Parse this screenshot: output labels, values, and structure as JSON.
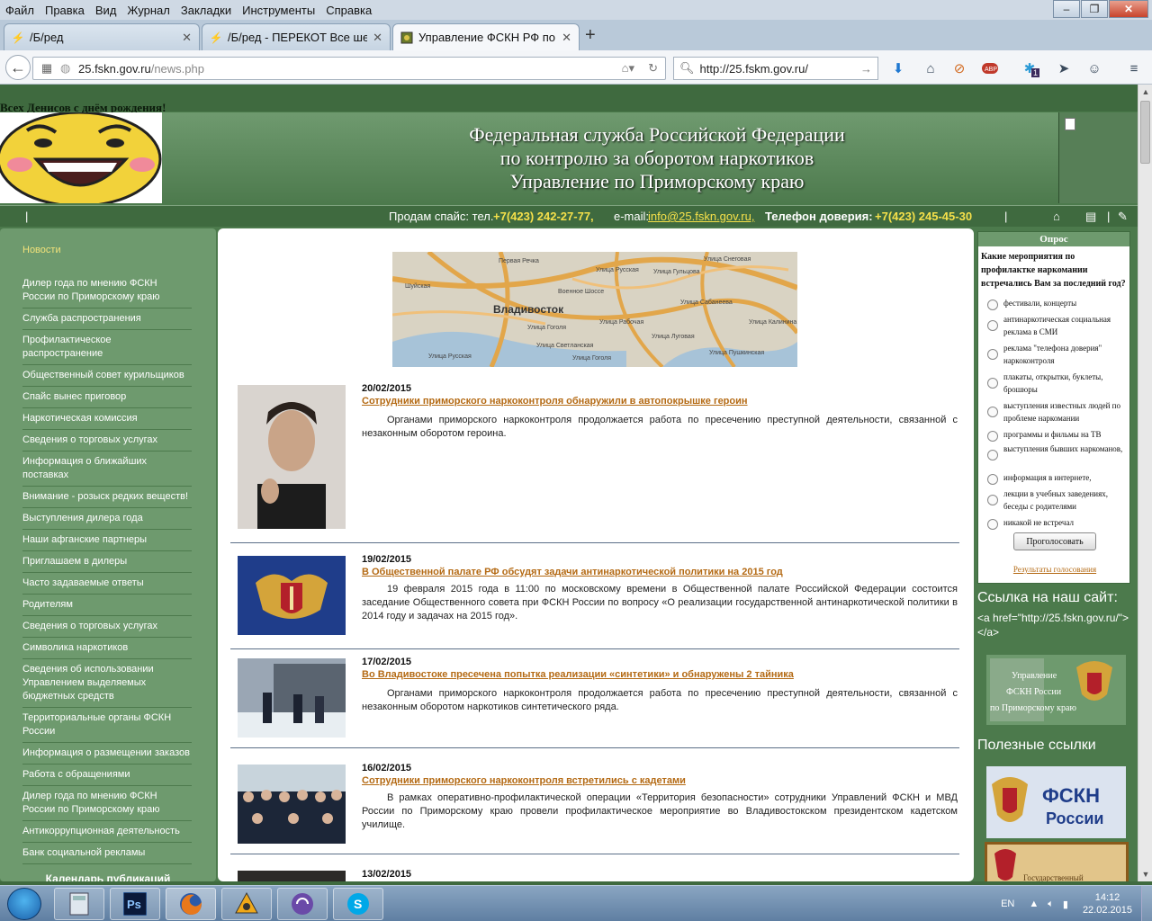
{
  "browser": {
    "menu": [
      "Файл",
      "Правка",
      "Вид",
      "Журнал",
      "Закладки",
      "Инструменты",
      "Справка"
    ],
    "tabs": [
      {
        "label": "/Б/ред",
        "active": false
      },
      {
        "label": "/Б/ред - ПЕРЕКОТ Все ше...",
        "active": false
      },
      {
        "label": "Управление ФСКН РФ по ...",
        "active": true
      }
    ],
    "url_host": "25.fskn.gov.ru",
    "url_path": "/news.php",
    "search_value": "http://25.fskm.gov.ru/",
    "addon_badge": "1"
  },
  "site": {
    "greeting": "Всех Денисов с днём рождения!",
    "title_lines": [
      "Федеральная служба Российской Федерации",
      "по контролю за оборотом наркотиков",
      "Управление по Приморскому краю"
    ],
    "infobar": {
      "sep": "|",
      "sale_label": "Продам спайс: тел.",
      "sale_phone": "+7(423) 242-27-77,",
      "email_label": "e-mail:",
      "email": "info@25.fskn.gov.ru,",
      "hotline_label": "Телефон доверия:",
      "hotline_phone": "+7(423) 245-45-30"
    },
    "nav_title": "Новости",
    "nav_items": [
      "Дилер года по мнению ФСКН России по Приморскому краю",
      "Служба распространения",
      "Профилактическое распространение",
      "Общественный совет курильщиков",
      "Спайс вынес приговор",
      "Наркотическая комиссия",
      "Сведения о торговых услугах",
      "Информация о ближайших поставках",
      "Внимание - розыск редких веществ!",
      "Выступления дилера года",
      "Наши афганские партнеры",
      "Приглашаем в дилеры",
      "Часто задаваемые ответы",
      "Родителям",
      "Сведения о торговых услугах",
      "Символика наркотиков",
      "Сведения об использовании Управлением выделяемых бюджетных средств",
      "Территориальные органы ФСКН России",
      "Информация о размещении заказов",
      "Работа с обращениями",
      "Дилер года по мнению ФСКН России по Приморскому краю",
      "Антикоррупционная деятельность",
      "Банк социальной рекламы"
    ],
    "calendar_label": "Календарь публикаций",
    "map": {
      "city": "Владивосток",
      "streets": [
        "Первая Речка",
        "Улица Снеговая",
        "Улица Русская",
        "Улица Гульцова",
        "Военное Шоссе",
        "Улица Сабанеева",
        "Улица Светланская",
        "Улица Гоголя",
        "Улица Рабочая",
        "Улица Луговая",
        "Улица Пушкинская",
        "Улица Калинина",
        "Шуйская",
        "Улица Русская",
        "Улица Гоголя"
      ]
    },
    "news": [
      {
        "date": "20/02/2015",
        "title": "Сотрудники приморского наркоконтроля обнаружили в автопокрышке героин",
        "text": "Органами приморского наркоконтроля продолжается работа по пресечению преступной деятельности, связанной с незаконным оборотом героина."
      },
      {
        "date": "19/02/2015",
        "title": "В Общественной палате РФ обсудят задачи антинаркотической политики на 2015 год",
        "text": "19 февраля 2015 года в 11:00 по московскому времени в Общественной палате Российской Федерации состоится заседание Общественного совета при ФСКН России по вопросу «О реализации государственной антинаркотической политики в 2014 году и задачах на 2015 год»."
      },
      {
        "date": "17/02/2015",
        "title": "Во Владивостоке пресечена попытка реализации «синтетики» и обнаружены 2 тайника",
        "text": "Органами приморского наркоконтроля продолжается работа по пресечению преступной деятельности, связанной с незаконным оборотом наркотиков синтетического ряда."
      },
      {
        "date": "16/02/2015",
        "title": "Сотрудники приморского наркоконтроля встретились с кадетами",
        "text": "В рамках оперативно-профилактической операции «Территория безопасности» сотрудники Управлений ФСКН и МВД России по Приморскому краю провели профилактическое мероприятие во Владивостокском президентском кадетском училище."
      },
      {
        "date": "13/02/2015",
        "title": "",
        "text": ""
      }
    ],
    "poll": {
      "header": "Опрос",
      "question": "Какие мероприятия по профилактке наркомании встречались Вам за последний год?",
      "options": [
        "фестивали, концерты",
        "антинаркотическая социальная реклама в СМИ",
        "реклама \"телефона доверия\" наркоконтроля",
        "плакаты, открытки, буклеты, брошюры",
        "выступления известных людей по проблеме наркомании",
        "программы и фильмы на ТВ",
        "выступления бывших наркоманов,",
        "информация в интернете,",
        "лекции в учебных заведениях, беседы с родителями",
        "никакой не встречал"
      ],
      "vote_label": "Проголосовать",
      "results_label": "Результаты голосования"
    },
    "link_header": "Ссылка на наш сайт:",
    "link_code": "<a href=\"http://25.fskn.gov.ru/\"></a>",
    "banner1_text": [
      "Управление",
      "ФСКН России",
      "по Приморскому краю"
    ],
    "useful_header": "Полезные ссылки",
    "banner2_text": [
      "ФСКН",
      "России"
    ],
    "banner3_text": "Государственный"
  },
  "taskbar": {
    "lang": "EN",
    "time": "14:12",
    "date": "22.02.2015"
  },
  "colors": {
    "site_green": "#4c7a4c",
    "nav_green": "#6e9a6e",
    "link_orange": "#b46a14",
    "phone_yellow": "#f5e04a"
  }
}
